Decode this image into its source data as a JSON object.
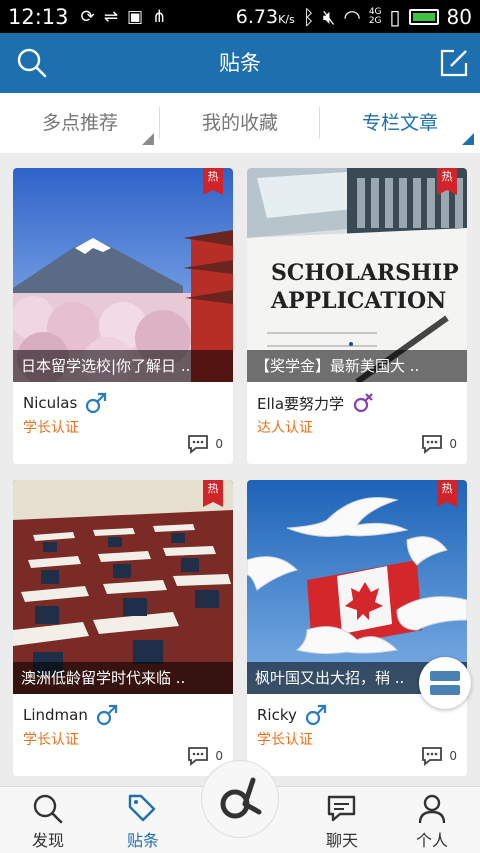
{
  "status_bar": {
    "time": "12:13",
    "speed": "6.73",
    "speed_unit": "K/s",
    "net_4g": "4G",
    "net_2g": "2G",
    "battery_pct": "80",
    "battery_level": 0.8
  },
  "header": {
    "title": "贴条"
  },
  "tabs": [
    {
      "label": "多点推荐",
      "active": false
    },
    {
      "label": "我的收藏",
      "active": false
    },
    {
      "label": "专栏文章",
      "active": true
    }
  ],
  "hot_label": "热",
  "cards": [
    {
      "caption": "日本留学选校|你了解日 ..",
      "author": "Niculas",
      "gender": "male",
      "badge": "学长认证",
      "comments": "0",
      "image": "mount-fuji-pagoda",
      "image_text": ""
    },
    {
      "caption": "【奖学金】最新美国大 ..",
      "author": "Ella要努力学",
      "gender": "female",
      "badge": "达人认证",
      "comments": "0",
      "image": "scholarship-application",
      "image_text": "SCHOLARSHIP APPLICATION"
    },
    {
      "caption": "澳洲低龄留学时代来临 ..",
      "author": "Lindman",
      "gender": "male",
      "badge": "学长认证",
      "comments": "0",
      "image": "classroom-desks",
      "image_text": ""
    },
    {
      "caption": "枫叶国又出大招，稍 ..",
      "author": "Ricky",
      "gender": "male",
      "badge": "学长认证",
      "comments": "0",
      "image": "seagulls-canada-flag",
      "image_text": ""
    }
  ],
  "bottom_nav": [
    {
      "label": "发现",
      "icon": "search-icon",
      "active": false
    },
    {
      "label": "贴条",
      "icon": "tag-icon",
      "active": true
    },
    {
      "label": "",
      "icon": "logo-icon",
      "active": false
    },
    {
      "label": "聊天",
      "icon": "chat-icon",
      "active": false
    },
    {
      "label": "个人",
      "icon": "person-icon",
      "active": false
    }
  ],
  "colors": {
    "header": "#1e6fad",
    "badge": "#e8721c",
    "hot": "#d0242a",
    "male": "#2a7cc0",
    "female": "#8a3fb0"
  }
}
